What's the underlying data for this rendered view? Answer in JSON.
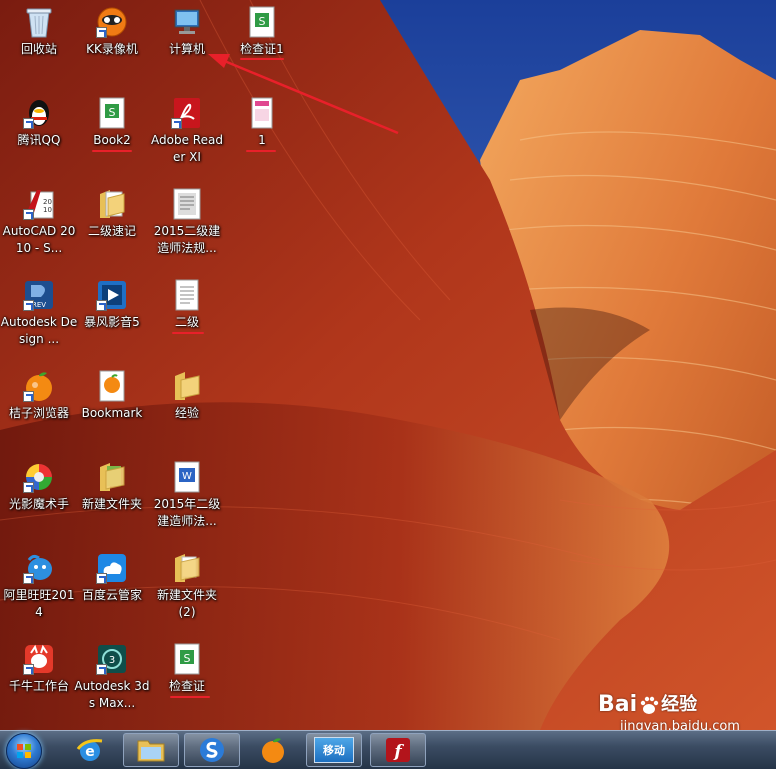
{
  "desktop": {
    "icons": [
      {
        "label": "回收站",
        "icon": "recycle-bin-icon"
      },
      {
        "label": "KK录像机",
        "icon": "kk-recorder-icon"
      },
      {
        "label": "计算机",
        "icon": "computer-icon"
      },
      {
        "label": "检查证1",
        "icon": "spreadsheet-file-icon"
      },
      {
        "label": "腾讯QQ",
        "icon": "qq-penguin-icon"
      },
      {
        "label": "Book2",
        "icon": "spreadsheet-file-icon"
      },
      {
        "label": "Adobe Reader XI",
        "icon": "adobe-reader-icon"
      },
      {
        "label": "1",
        "icon": "image-file-icon"
      },
      {
        "label": "AutoCAD 2010 - S...",
        "icon": "autocad-icon"
      },
      {
        "label": "二级速记",
        "icon": "folder-icon"
      },
      {
        "label": "2015二级建造师法规...",
        "icon": "document-scan-icon"
      },
      {
        "label": "Autodesk Design ...",
        "icon": "autodesk-design-review-icon"
      },
      {
        "label": "暴风影音5",
        "icon": "baofeng-player-icon"
      },
      {
        "label": "二级",
        "icon": "text-file-icon"
      },
      {
        "label": "桔子浏览器",
        "icon": "orange-browser-icon"
      },
      {
        "label": "Bookmark",
        "icon": "bookmark-icon"
      },
      {
        "label": "经验",
        "icon": "folder-icon"
      },
      {
        "label": "光影魔术手",
        "icon": "nevercenter-photo-icon"
      },
      {
        "label": "新建文件夹",
        "icon": "folder-icon"
      },
      {
        "label": "2015年二级建造师法...",
        "icon": "wps-document-icon"
      },
      {
        "label": "阿里旺旺2014",
        "icon": "aliwangwang-icon"
      },
      {
        "label": "百度云管家",
        "icon": "baidu-cloud-icon"
      },
      {
        "label": "新建文件夹 (2)",
        "icon": "folder-icon"
      },
      {
        "label": "千牛工作台",
        "icon": "qianniu-icon"
      },
      {
        "label": "Autodesk 3ds Max...",
        "icon": "3dsmax-icon"
      },
      {
        "label": "检查证",
        "icon": "spreadsheet-file-icon"
      }
    ]
  },
  "taskbar": {
    "start": "start-orb-icon",
    "items": [
      {
        "name": "internet-explorer-icon"
      },
      {
        "name": "file-explorer-icon"
      },
      {
        "name": "sogou-browser-icon"
      },
      {
        "name": "orange-browser-icon"
      },
      {
        "name": "mobile-app-icon",
        "label": "移动"
      },
      {
        "name": "flash-player-icon"
      }
    ]
  },
  "watermark": {
    "logo": "Bai",
    "logo_cn": "经验",
    "url": "jingyan.baidu.com"
  },
  "colors": {
    "annotation_red": "#e8202a",
    "taskbar": "#3b4c63"
  }
}
